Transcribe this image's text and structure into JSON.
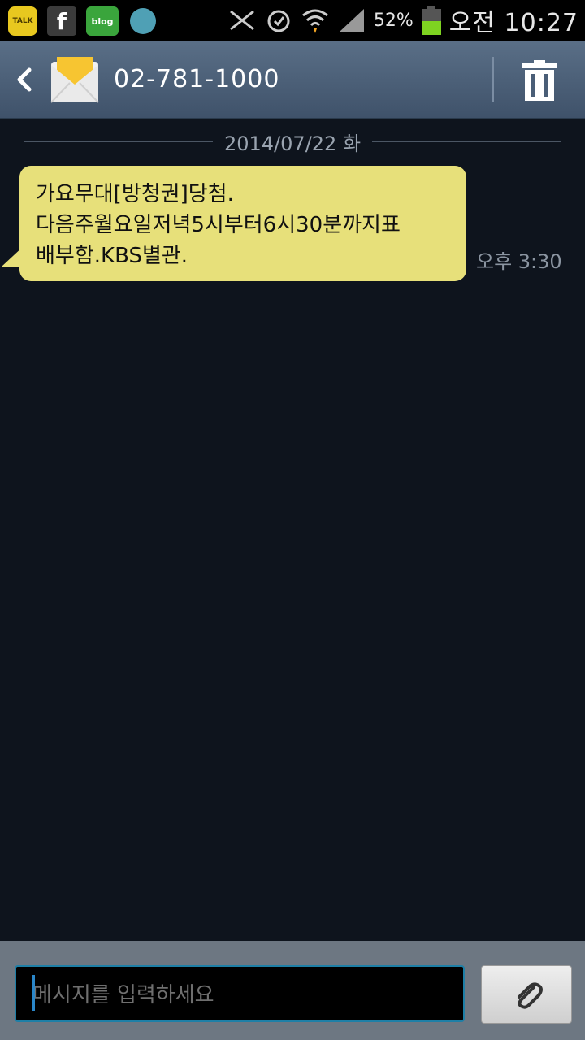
{
  "statusbar": {
    "apps": [
      {
        "name": "talk",
        "label": "TALK"
      },
      {
        "name": "facebook",
        "label": "f"
      },
      {
        "name": "blog",
        "label": "blog"
      }
    ],
    "battery_percent": "52%",
    "battery_level": 0.52,
    "time": "오전 10:27"
  },
  "header": {
    "contact": "02-781-1000"
  },
  "conversation": {
    "date": "2014/07/22 화",
    "message": {
      "text": "가요무대[방청권]당첨.\n다음주월요일저녁5시부터6시30분까지표\n배부함.KBS별관.",
      "time": "오후 3:30"
    }
  },
  "composer": {
    "placeholder": "메시지를 입력하세요"
  },
  "colors": {
    "bubble": "#e7e07a",
    "background": "#0e141d",
    "actionbar": "#4a5e77"
  }
}
